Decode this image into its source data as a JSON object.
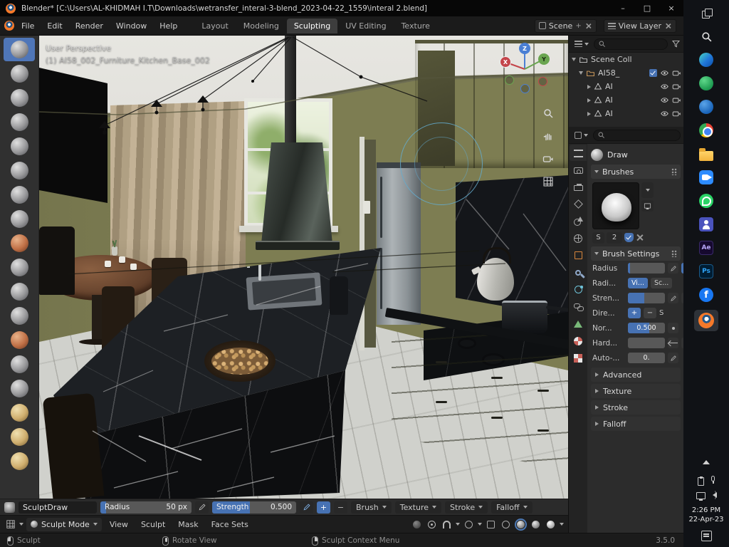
{
  "colors": {
    "accent": "#4772b3",
    "blender_orange": "#f5792a"
  },
  "titlebar": {
    "title": "Blender* [C:\\Users\\AL-KHIDMAH I.T\\Downloads\\wetransfer_interal-3-blend_2023-04-22_1559\\interal 2.blend]",
    "minimize": "–",
    "maximize": "□",
    "close": "×"
  },
  "menubar": {
    "menus": [
      "File",
      "Edit",
      "Render",
      "Window",
      "Help"
    ],
    "workspaces": [
      "Layout",
      "Modeling",
      "Sculpting",
      "UV Editing",
      "Texture"
    ],
    "scene_label": "Scene",
    "view_layer_label": "View Layer"
  },
  "viewport": {
    "overlay_line1": "User Perspective",
    "overlay_line2": "(1) AI58_002_Furniture_Kitchen_Base_002",
    "axis_x": "X",
    "axis_y": "Y",
    "axis_z": "Z"
  },
  "outliner": {
    "scene_collection": "Scene Coll",
    "rows": [
      {
        "label": "AI58_"
      },
      {
        "label": "AI"
      },
      {
        "label": "AI"
      },
      {
        "label": "AI"
      }
    ]
  },
  "properties": {
    "tool_name": "Draw",
    "brushes_header": "Brushes",
    "size_label": "S",
    "size_value": "2",
    "settings_header": "Brush Settings",
    "radius_label": "Radius",
    "radius_fill": "5%",
    "radius2_label": "Radi...",
    "radius_unit_buttons": [
      "Vi...",
      "Sc..."
    ],
    "strength_label": "Stren...",
    "strength_fill": "45%",
    "direction_label": "Dire...",
    "direction_plus": "+",
    "direction_minus": "−",
    "direction_s": "S",
    "normal_label": "Nor...",
    "normal_value": "0.500",
    "normal_fill": "58%",
    "hardness_label": "Hard...",
    "autosmooth_label": "Auto-...",
    "autosmooth_value": "0.",
    "sections": [
      "Advanced",
      "Texture",
      "Stroke",
      "Falloff"
    ]
  },
  "tool_settings": {
    "tool_name": "SculptDraw",
    "radius_label": "Radius",
    "radius_value": "50 px",
    "radius_fill": "6%",
    "strength_label": "Strength",
    "strength_value": "0.500",
    "strength_fill": "45%",
    "plus": "+",
    "minus": "−",
    "dropdowns": [
      "Brush",
      "Texture",
      "Stroke",
      "Falloff"
    ]
  },
  "viewport_header": {
    "mode": "Sculpt Mode",
    "menus": [
      "View",
      "Sculpt",
      "Mask",
      "Face Sets"
    ]
  },
  "statusbar": {
    "left": "Sculpt",
    "middle": "Rotate View",
    "right": "Sculpt Context Menu",
    "version": "3.5.0"
  },
  "taskbar": {
    "ae_label": "Ae",
    "ps_label": "Ps",
    "facebook_label": "f",
    "time": "2:26 PM",
    "date": "22-Apr-23"
  }
}
